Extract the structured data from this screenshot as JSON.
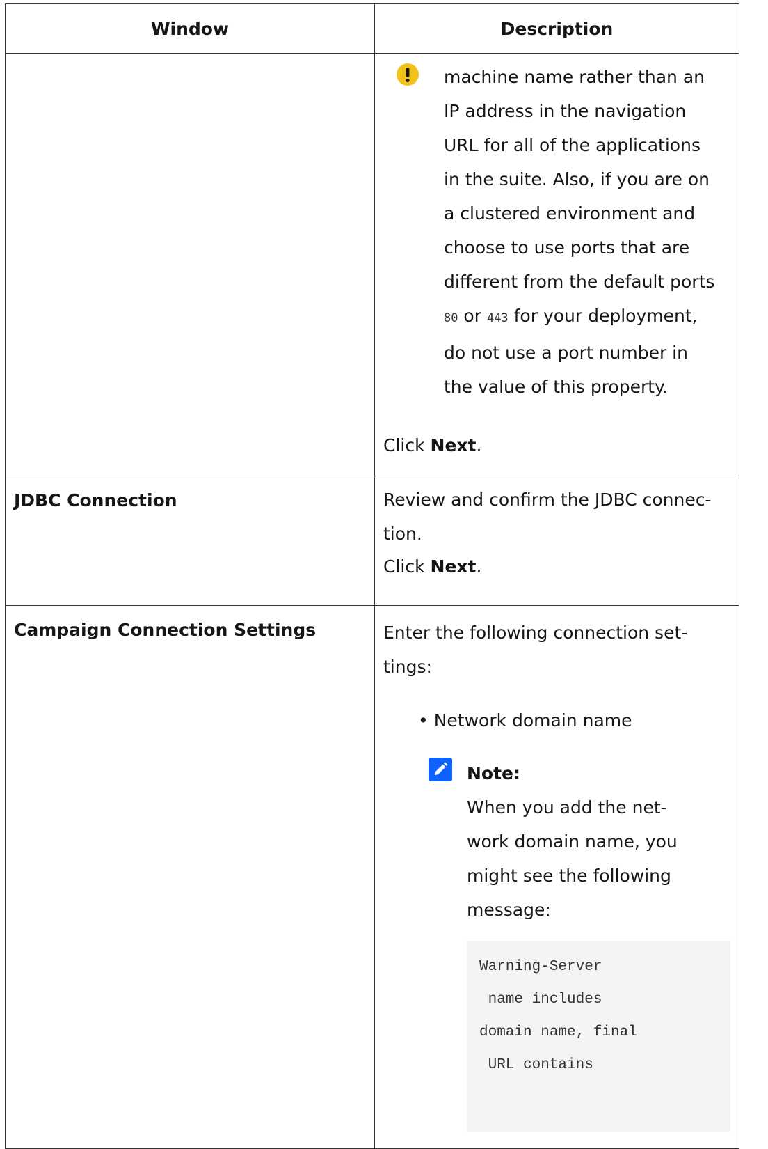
{
  "table": {
    "headers": {
      "window": "Window",
      "description": "Description"
    },
    "rows": [
      {
        "window": "",
        "important_icon": "important-exclamation-icon",
        "important_lines": [
          "machine name rather than an",
          "IP address in the navigation",
          "URL for all of the applications",
          "in the suite. Also, if you are on",
          "a clustered environment and",
          "choose to use ports that are",
          "different from the default ports"
        ],
        "port_80": "80",
        "port_or": " or ",
        "port_443": "443",
        "port_tail": " for your deployment,",
        "important_lines_after": [
          "do not use a port number in",
          "the value of this property."
        ],
        "click_prefix": "Click ",
        "click_bold": "Next",
        "click_suffix": "."
      },
      {
        "window": "JDBC Connection",
        "desc_lines": [
          "Review and confirm the JDBC connec-",
          "tion."
        ],
        "click_prefix": "Click ",
        "click_bold": "Next",
        "click_suffix": "."
      },
      {
        "window": "Campaign Connection Settings",
        "desc_lines": [
          "Enter the following connection set-",
          "tings:"
        ],
        "bullet": "• Network domain name",
        "note_icon": "pencil-note-icon",
        "note_title": "Note:",
        "note_lines": [
          "When you add the net-",
          "work domain name, you",
          "might see the following",
          "message:"
        ],
        "code_lines": [
          "Warning-Server",
          " name includes",
          "domain name, final",
          " URL contains"
        ]
      }
    ]
  },
  "colors": {
    "important_icon": "#f1c21b",
    "note_icon": "#0f62fe",
    "border": "#333333",
    "code_background": "#f4f4f4"
  }
}
